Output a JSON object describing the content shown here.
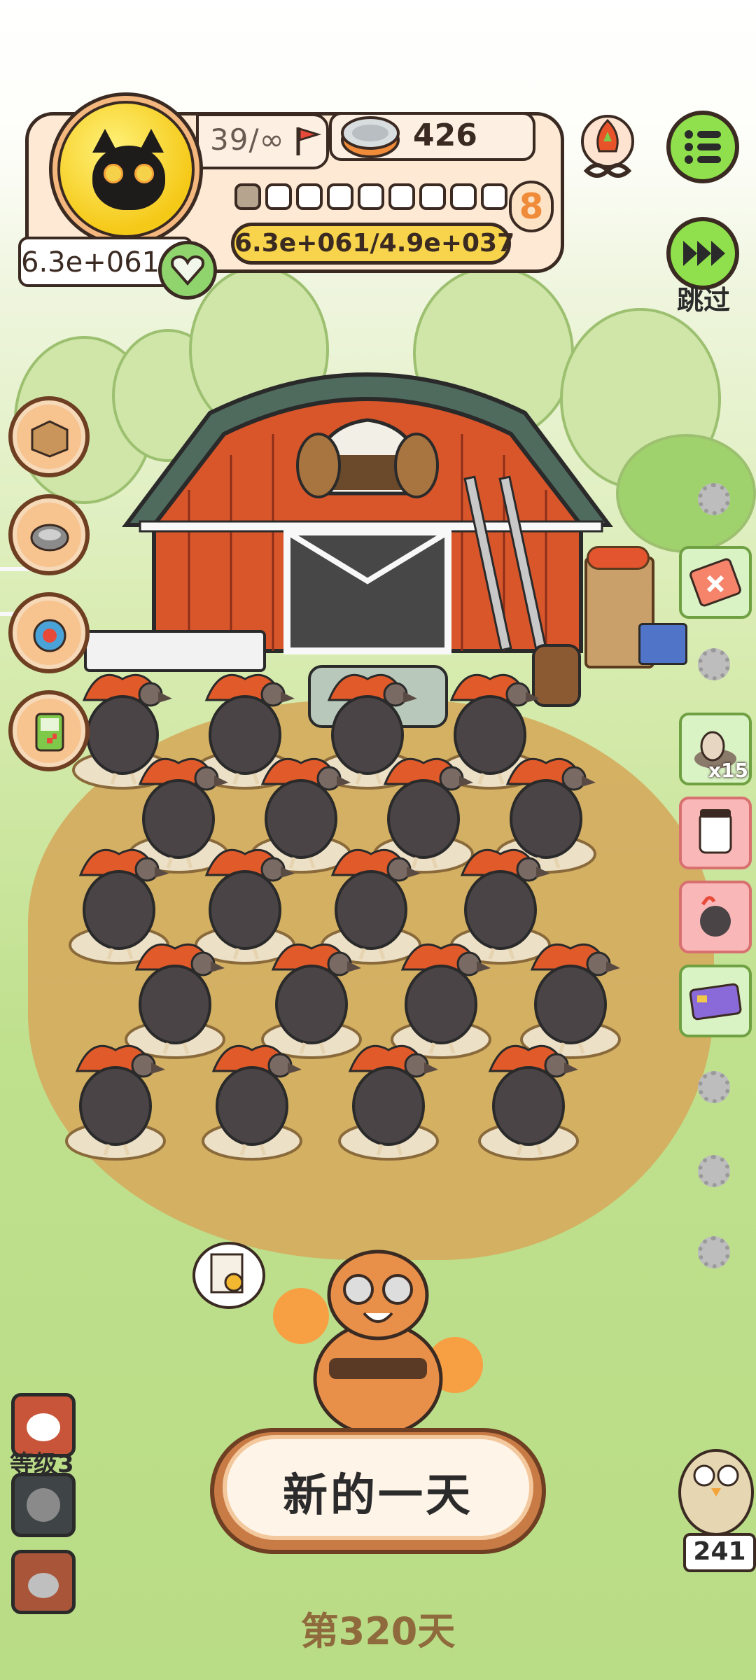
{
  "hud": {
    "level_text": "39/∞",
    "currency_value": "426",
    "progress_text": "6.3e+061/4.9e+037",
    "gold_value": "6.3e+061",
    "stage_badge": "8",
    "progress_dots_total": 9,
    "progress_dots_filled": 1
  },
  "controls": {
    "skip_label": "跳过",
    "new_day_label": "新的一天",
    "day_counter": "第320天",
    "level_label": "等级3",
    "bird_count": "241",
    "item_multiplier": "x15"
  },
  "icons": {
    "avatar": "black-cat-avatar",
    "currency": "cat-food-can-icon",
    "menu": "menu-list-icon",
    "skip": "fast-forward-icon",
    "top_right": "infinity-fire-badge-icon",
    "side_left": [
      "box-icon",
      "food-bowl-icon",
      "timer-icon",
      "gameboy-icon"
    ],
    "side_right": [
      "ticket-icon",
      "egg-nest-icon",
      "jar-icon",
      "heart-bird-icon",
      "credit-card-icon"
    ]
  },
  "farm": {
    "animal": "turkey",
    "count": 22
  },
  "colors": {
    "accent_green": "#8fe04c",
    "hud_bg": "#fde9d4",
    "gold_pill": "#f7d44c",
    "dirt": "#d5ab5e",
    "outline": "#3a2a22"
  }
}
